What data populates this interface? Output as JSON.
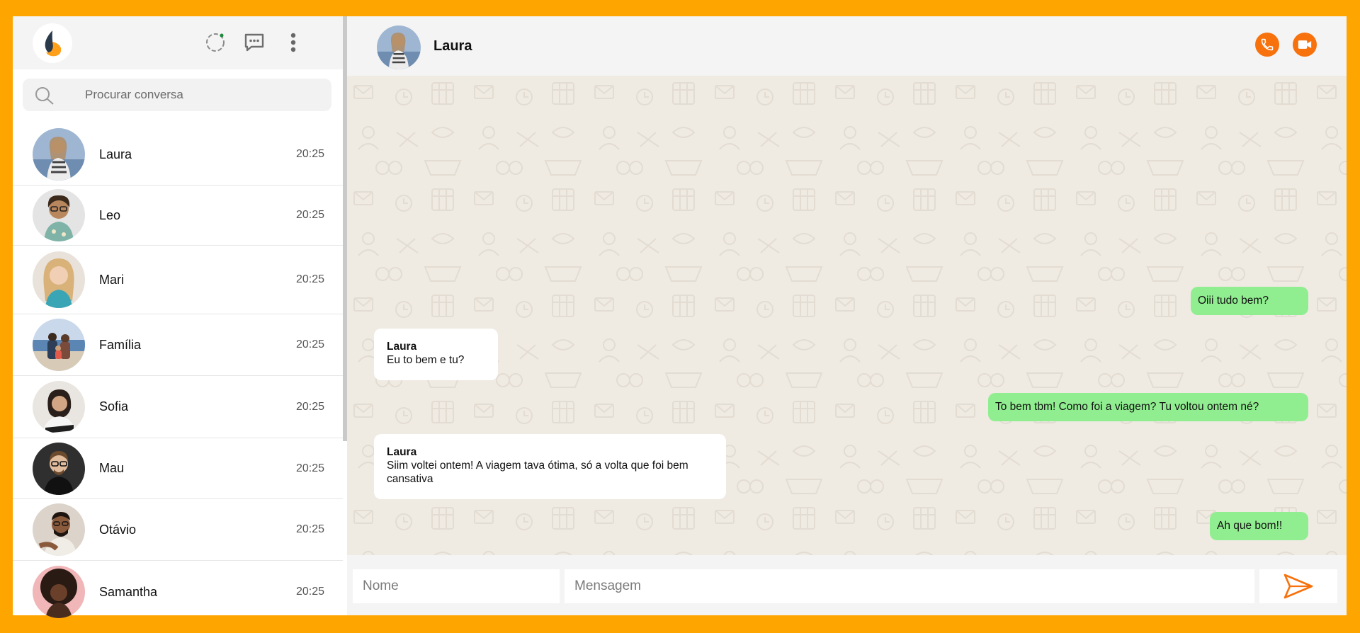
{
  "sidebar": {
    "search": {
      "placeholder": "Procurar conversa"
    },
    "header_icons": [
      "status-icon",
      "new-chat-icon",
      "menu-icon"
    ],
    "contacts": [
      {
        "name": "Laura",
        "time": "20:25",
        "avatar_color": "#9db7d6"
      },
      {
        "name": "Leo",
        "time": "20:25",
        "avatar_color": "#c9c2b8"
      },
      {
        "name": "Mari",
        "time": "20:25",
        "avatar_color": "#d8b7a0"
      },
      {
        "name": "Família",
        "time": "20:25",
        "avatar_color": "#7c8ea6"
      },
      {
        "name": "Sofia",
        "time": "20:25",
        "avatar_color": "#cfcac4"
      },
      {
        "name": "Mau",
        "time": "20:25",
        "avatar_color": "#3a3a3a"
      },
      {
        "name": "Otávio",
        "time": "20:25",
        "avatar_color": "#d9cfc5"
      },
      {
        "name": "Samantha",
        "time": "20:25",
        "avatar_color": "#e8a6a9"
      }
    ]
  },
  "chat": {
    "title": "Laura",
    "messages": [
      {
        "type": "sent",
        "text": "Oiii tudo bem?"
      },
      {
        "type": "recv",
        "author": "Laura",
        "text": "Eu to bem e tu?"
      },
      {
        "type": "sent",
        "text": "To bem tbm! Como foi a viagem? Tu voltou ontem né?"
      },
      {
        "type": "recv",
        "author": "Laura",
        "text": "Siim voltei ontem! A viagem tava ótima, só a volta que foi bem cansativa"
      },
      {
        "type": "sent",
        "text": "Ah que bom!!"
      }
    ]
  },
  "composer": {
    "name_placeholder": "Nome",
    "message_placeholder": "Mensagem"
  },
  "colors": {
    "frame": "#ffa500",
    "accent": "#f7710c",
    "sent_bubble": "#90ee90",
    "chat_background": "#efeae2"
  }
}
